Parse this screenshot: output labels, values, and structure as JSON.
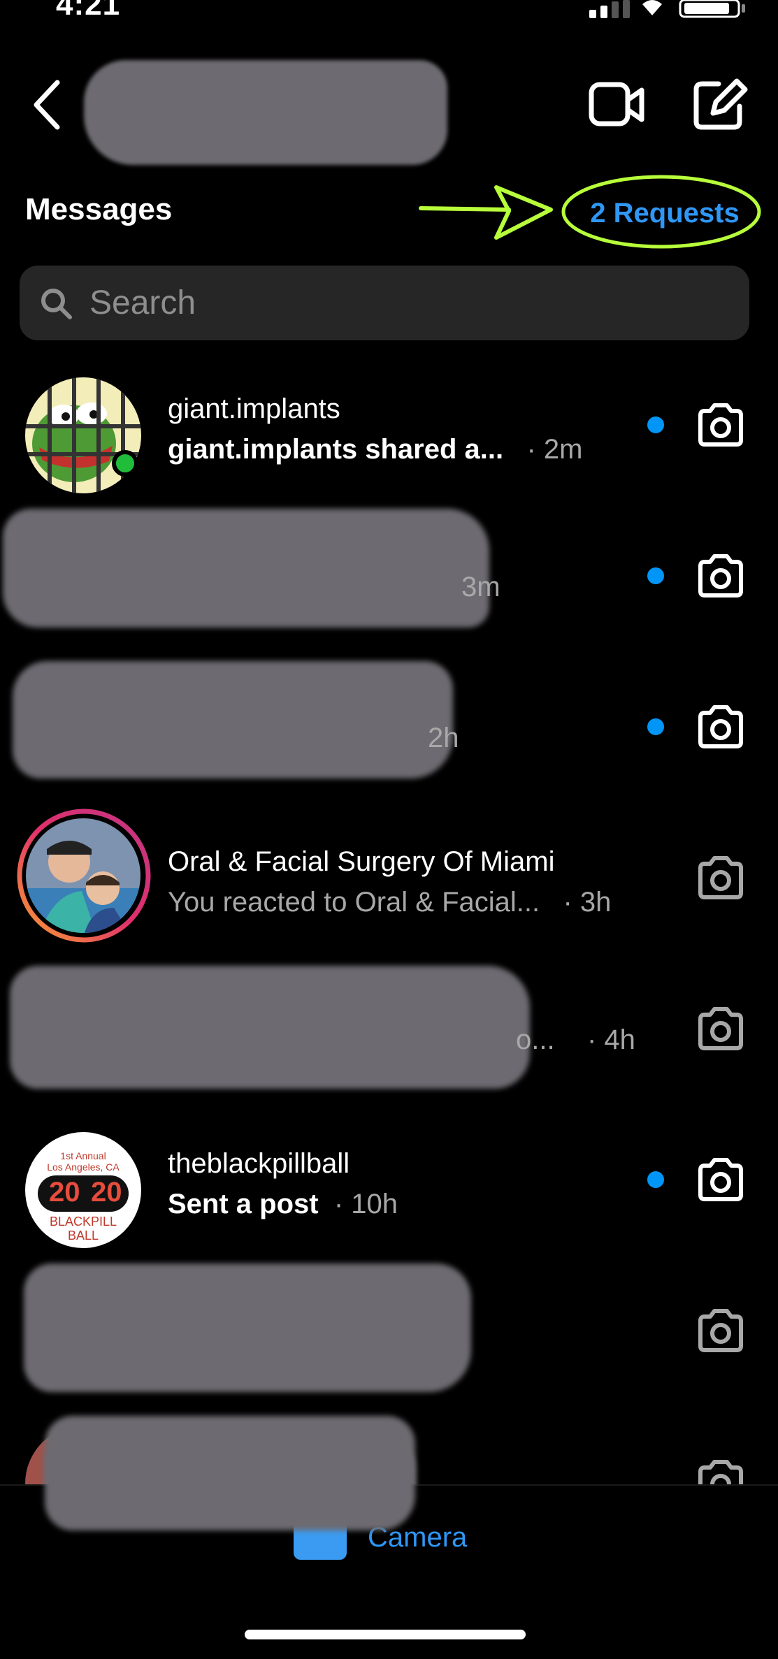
{
  "status_bar": {
    "time": "4:21"
  },
  "header": {
    "section_title": "Messages",
    "requests_label": "2 Requests"
  },
  "search": {
    "placeholder": "Search"
  },
  "threads": [
    {
      "name": "giant.implants",
      "preview": "giant.implants shared a...",
      "time": "· 2m",
      "unread": true,
      "online": true
    },
    {
      "name": "",
      "preview": "",
      "time": "3m",
      "unread": true,
      "redacted": true
    },
    {
      "name": "",
      "preview": "",
      "time": "2h",
      "unread": true,
      "redacted": true
    },
    {
      "name": "Oral & Facial Surgery Of Miami",
      "preview": "You reacted to Oral & Facial...",
      "time": "· 3h",
      "unread": false,
      "story_ring": true
    },
    {
      "name": "",
      "preview": "o...",
      "time": "· 4h",
      "unread": false,
      "redacted": true
    },
    {
      "name": "theblackpillball",
      "preview": "Sent a post",
      "time": "· 10h",
      "unread": true
    },
    {
      "name": "",
      "preview": "",
      "time": "",
      "unread": false,
      "redacted": true
    },
    {
      "name": "",
      "preview": "",
      "time": "",
      "unread": false,
      "redacted": true
    }
  ],
  "blackpill_avatar": {
    "line1": "1st Annual",
    "line2": "Los Angeles, CA",
    "year_left": "20",
    "year_right": "20",
    "line3": "BLACKPILL",
    "line4": "BALL"
  },
  "bottom_bar": {
    "camera_label": "Camera"
  },
  "colors": {
    "accent": "#0095f6",
    "annotation": "#b7ff3a",
    "online": "#1fbd3a"
  }
}
